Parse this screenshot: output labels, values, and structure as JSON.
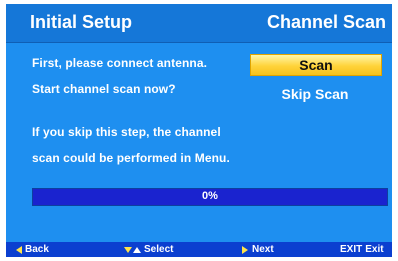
{
  "header": {
    "title": "Initial Setup",
    "section": "Channel Scan"
  },
  "content": {
    "line1": "First, please connect antenna.",
    "line2": "Start channel scan now?",
    "line3": "If you skip this step, the channel",
    "line4": "scan could be performed in Menu."
  },
  "buttons": {
    "scan_label": "Scan",
    "skip_label": "Skip Scan"
  },
  "progress": {
    "value": 0,
    "label": "0%"
  },
  "footer": {
    "back_label": "Back",
    "select_label": "Select",
    "next_label": "Next",
    "exit_key": "EXIT",
    "exit_label": "Exit"
  },
  "colors": {
    "background": "#1e8ff0",
    "header": "#1577d8",
    "highlight": "#ffd33a",
    "progress_track": "#1a23cf",
    "footer": "#0b3fd0"
  }
}
